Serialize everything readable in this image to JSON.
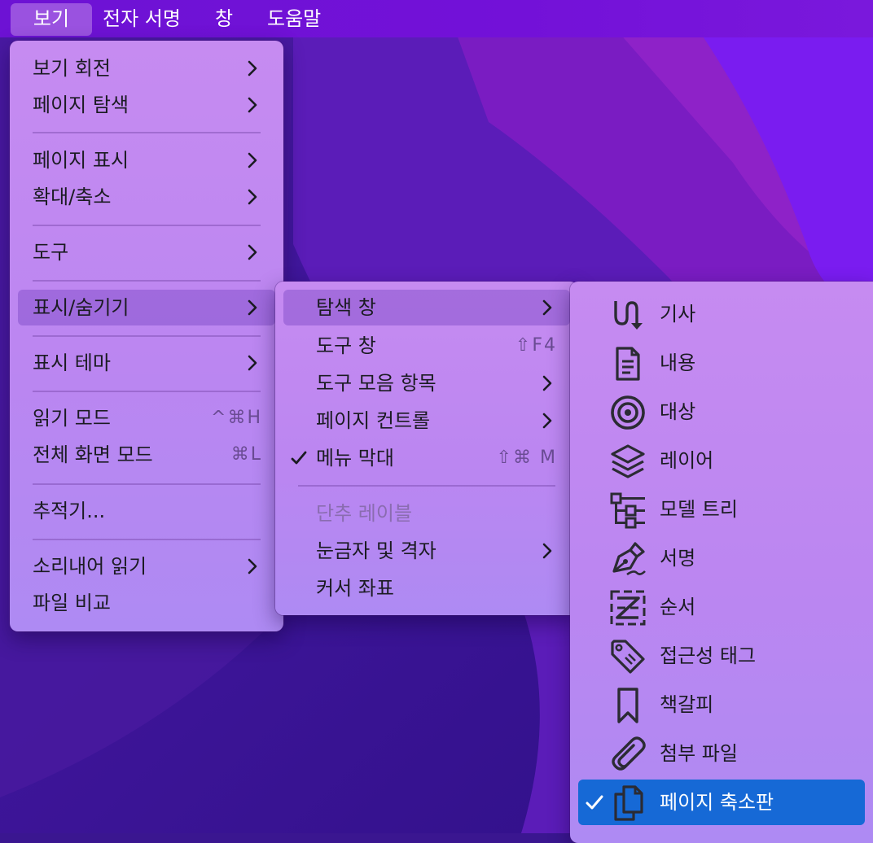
{
  "colors": {
    "accent": "#1669d6",
    "menubar": "#6d12d4"
  },
  "menubar": {
    "items": [
      "보기",
      "전자 서명",
      "창",
      "도움말"
    ]
  },
  "view_menu": {
    "items": [
      {
        "label": "보기 회전"
      },
      {
        "label": "페이지 탐색"
      },
      {
        "label": "페이지 표시"
      },
      {
        "label": "확대/축소"
      },
      {
        "label": "도구"
      },
      {
        "label": "표시/숨기기"
      },
      {
        "label": "표시 테마"
      },
      {
        "label": "읽기 모드",
        "shortcut": "^⌘H"
      },
      {
        "label": "전체 화면 모드",
        "shortcut": "⌘L"
      },
      {
        "label": "추적기..."
      },
      {
        "label": "소리내어 읽기"
      },
      {
        "label": "파일 비교"
      }
    ]
  },
  "show_hide_menu": {
    "items": [
      {
        "label": "탐색 창"
      },
      {
        "label": "도구 창",
        "shortcut": "⇧F4"
      },
      {
        "label": "도구 모음 항목"
      },
      {
        "label": "페이지 컨트롤"
      },
      {
        "label": "메뉴 막대",
        "shortcut": "⇧⌘ M",
        "checked": true
      },
      {
        "label": "단추 레이블",
        "disabled": true
      },
      {
        "label": "눈금자 및 격자"
      },
      {
        "label": "커서 좌표"
      }
    ]
  },
  "nav_pane_menu": {
    "items": [
      {
        "label": "기사",
        "icon": "article-flow-icon"
      },
      {
        "label": "내용",
        "icon": "document-content-icon"
      },
      {
        "label": "대상",
        "icon": "destination-target-icon"
      },
      {
        "label": "레이어",
        "icon": "layers-icon"
      },
      {
        "label": "모델 트리",
        "icon": "model-tree-icon"
      },
      {
        "label": "서명",
        "icon": "signature-pen-icon"
      },
      {
        "label": "순서",
        "icon": "order-icon"
      },
      {
        "label": "접근성 태그",
        "icon": "accessibility-tag-icon"
      },
      {
        "label": "책갈피",
        "icon": "bookmark-icon"
      },
      {
        "label": "첨부 파일",
        "icon": "paperclip-icon"
      },
      {
        "label": "페이지 축소판",
        "icon": "page-thumbnails-icon",
        "checked": true
      }
    ]
  }
}
